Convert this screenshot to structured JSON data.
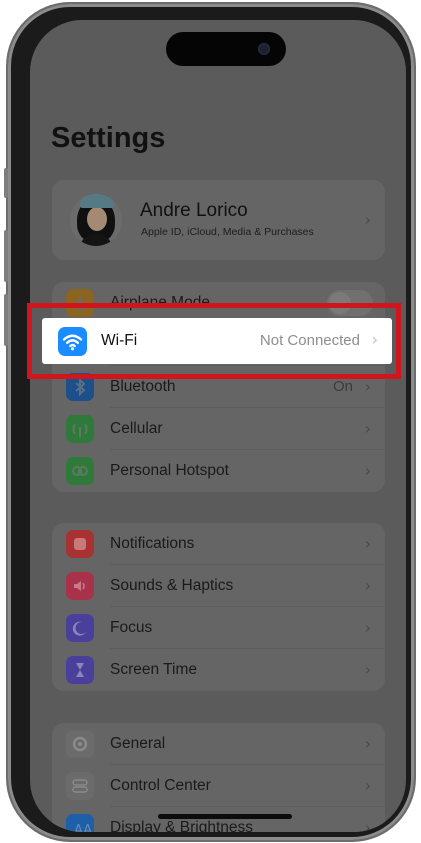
{
  "settings": {
    "title": "Settings",
    "profile": {
      "name": "Andre Lorico",
      "subtitle": "Apple ID, iCloud, Media & Purchases"
    },
    "group1": [
      {
        "label": "Airplane Mode",
        "icon": "airplane-icon",
        "color": "#8a6420",
        "control": "toggle"
      },
      {
        "label": "Wi-Fi",
        "icon": "wifi-icon",
        "color": "#1a8cff",
        "value": "Not Connected"
      },
      {
        "label": "Bluetooth",
        "icon": "bluetooth-icon",
        "color": "#1d4f8a",
        "value": "On"
      },
      {
        "label": "Cellular",
        "icon": "antenna-icon",
        "color": "#2f7a3a"
      },
      {
        "label": "Personal Hotspot",
        "icon": "hotspot-icon",
        "color": "#2f7a3a"
      }
    ],
    "group2": [
      {
        "label": "Notifications",
        "icon": "bell-icon",
        "color": "#a83232"
      },
      {
        "label": "Sounds & Haptics",
        "icon": "speaker-icon",
        "color": "#a8324a"
      },
      {
        "label": "Focus",
        "icon": "moon-icon",
        "color": "#4a3f9a"
      },
      {
        "label": "Screen Time",
        "icon": "hourglass-icon",
        "color": "#4a3f9a"
      }
    ],
    "group3": [
      {
        "label": "General",
        "icon": "gear-icon",
        "color": "#6b6b6b"
      },
      {
        "label": "Control Center",
        "icon": "switches-icon",
        "color": "#6b6b6b"
      },
      {
        "label": "Display & Brightness",
        "icon": "brightness-icon",
        "color": "#1d5fa8"
      }
    ],
    "chevron": "›"
  },
  "highlight_color": "#d0161c"
}
